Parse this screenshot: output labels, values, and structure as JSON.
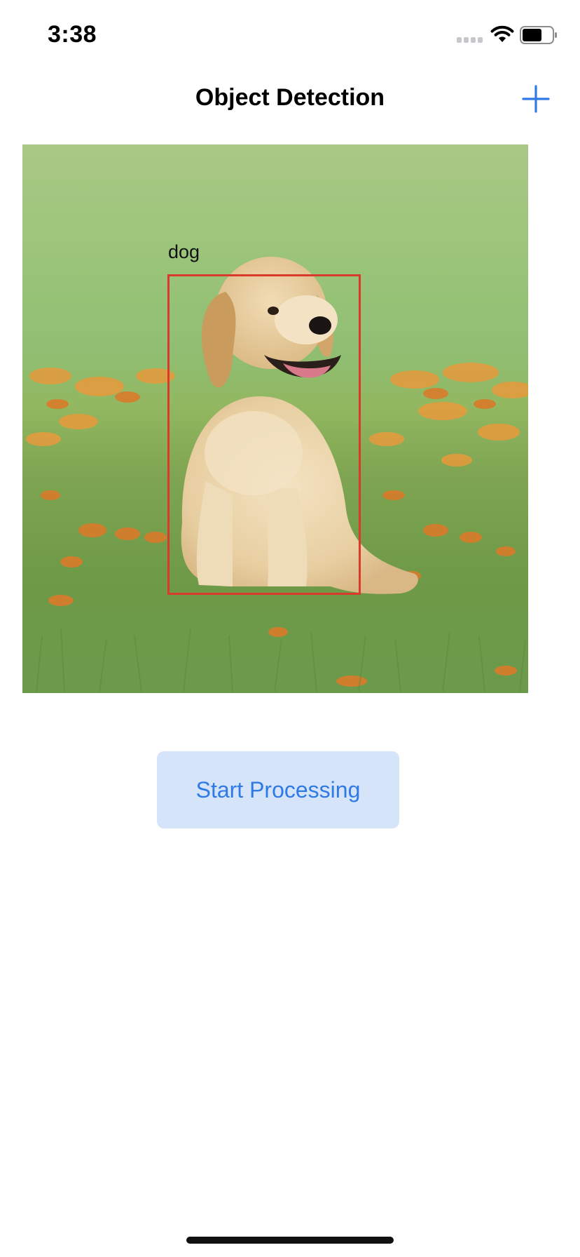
{
  "status_bar": {
    "time": "3:38"
  },
  "nav": {
    "title": "Object Detection",
    "add_icon": "plus-icon"
  },
  "detection": {
    "label": "dog"
  },
  "actions": {
    "start_label": "Start Processing"
  },
  "colors": {
    "accent": "#2f7ae5",
    "button_bg": "#d6e4fa",
    "box": "#d93a2b"
  }
}
